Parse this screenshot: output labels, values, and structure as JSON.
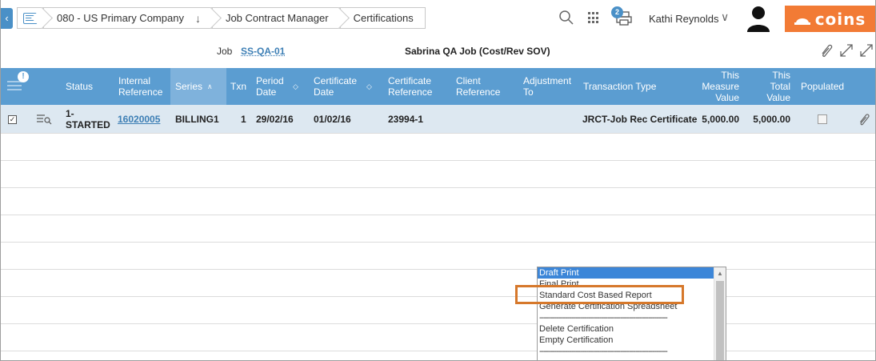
{
  "breadcrumb": {
    "company": "080 - US Primary Company",
    "module": "Job Contract Manager",
    "page": "Certifications"
  },
  "header": {
    "notification_count": "2",
    "username": "Kathi Reynolds",
    "logo_text": "coins",
    "brand_color": "#f27b35",
    "accent_color": "#5b9dd1"
  },
  "job": {
    "label": "Job",
    "code": "SS-QA-01",
    "description": "Sabrina QA Job (Cost/Rev SOV)"
  },
  "table": {
    "alert_badge": "!",
    "columns": {
      "status": "Status",
      "internal_reference": "Internal Reference",
      "series": "Series",
      "txn": "Txn",
      "period_date": "Period Date",
      "certificate_date": "Certificate Date",
      "certificate_reference": "Certificate Reference",
      "client_reference": "Client Reference",
      "adjustment_to": "Adjustment To",
      "transaction_type": "Transaction Type",
      "this_measure_value": "This Measure Value",
      "this_total_value": "This Total Value",
      "populated": "Populated"
    },
    "rows": [
      {
        "status": "1-STARTED",
        "internal_reference": "16020005",
        "series": "BILLING1",
        "txn": "1",
        "period_date": "29/02/16",
        "certificate_date": "01/02/16",
        "certificate_reference": "23994-1",
        "client_reference": "",
        "adjustment_to": "",
        "transaction_type": "JRCT-Job Rec Certificate",
        "this_measure_value": "5,000.00",
        "this_total_value": "5,000.00",
        "populated": false
      }
    ]
  },
  "dropdown": {
    "items": [
      "Draft Print",
      "Final Print",
      "Standard Cost Based Report",
      "Generate Certification Spreadsheet",
      "------------------------------------------------------------",
      "Delete Certification",
      "Empty Certification",
      "------------------------------------------------------------"
    ],
    "selected": "Draft Print",
    "highlighted": "Standard Cost Based Report"
  }
}
